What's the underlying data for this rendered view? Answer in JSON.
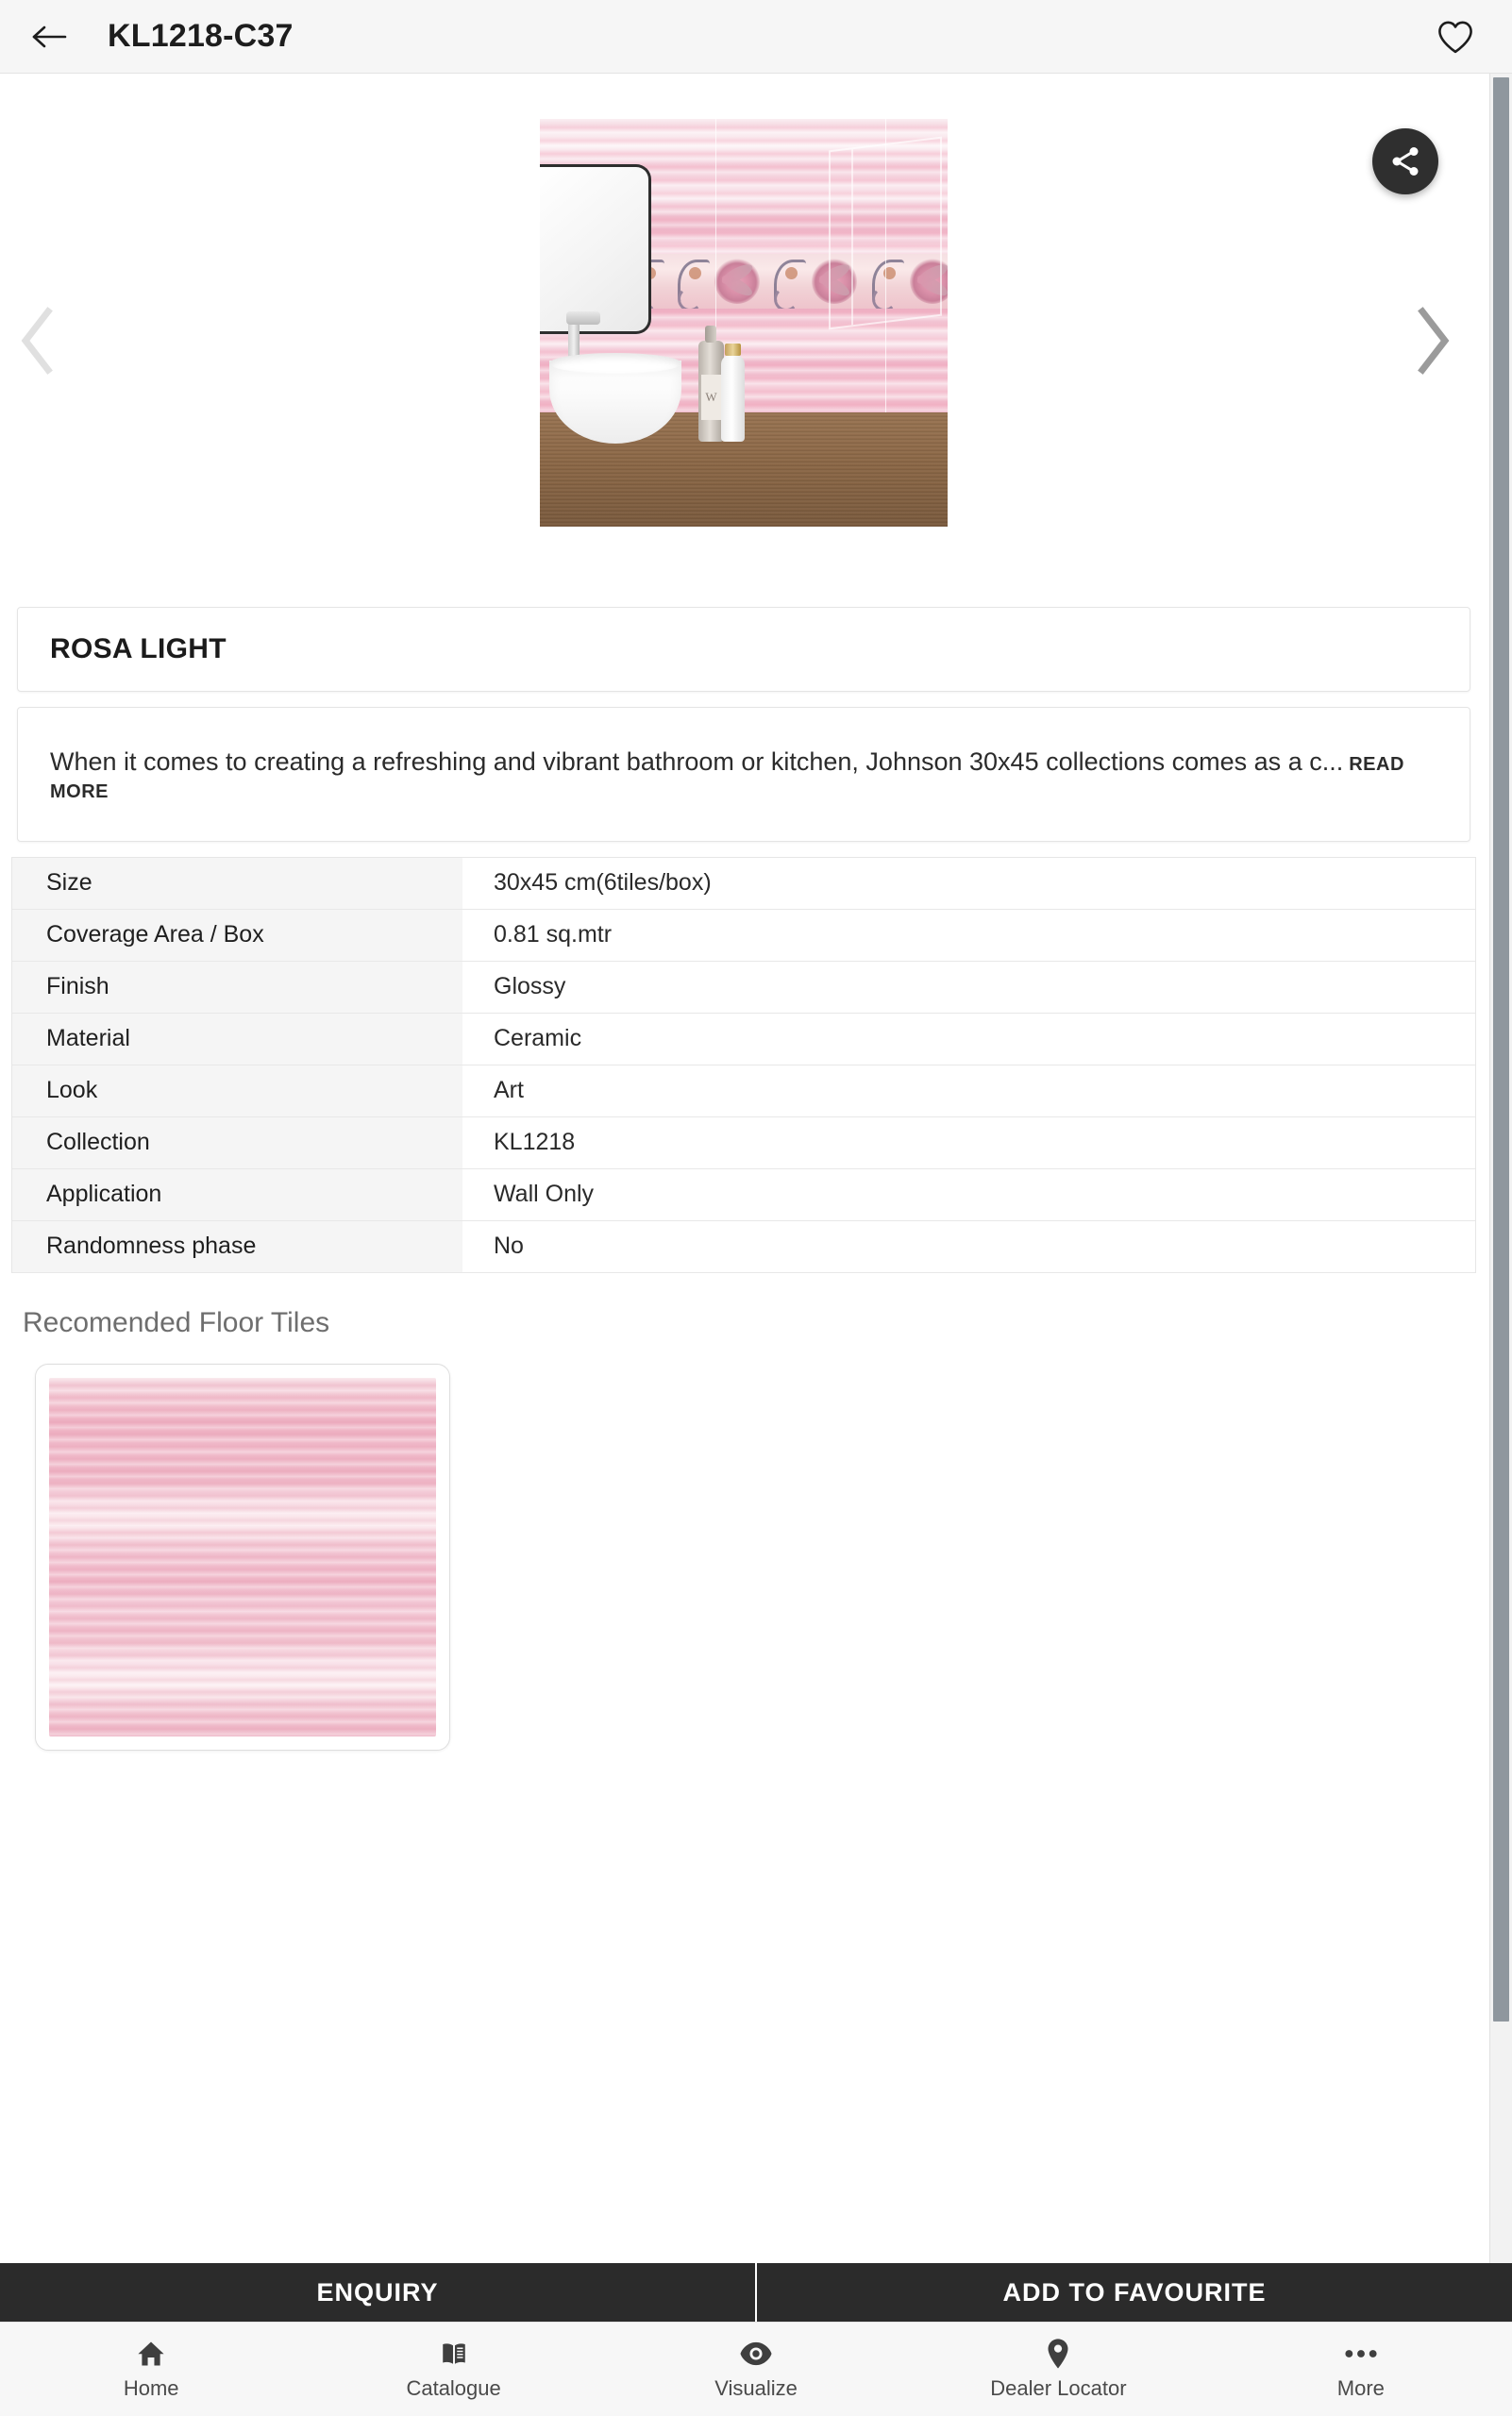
{
  "header": {
    "title": "KL1218-C37",
    "back_icon": "arrow-left-icon",
    "favourite_icon": "heart-outline-icon"
  },
  "carousel": {
    "prev_icon": "chevron-left-icon",
    "next_icon": "chevron-right-icon",
    "share_icon": "share-icon",
    "image_alt": "ROSA LIGHT pink striped bathroom wall tile with floral decor band"
  },
  "product": {
    "name": "ROSA LIGHT",
    "description": "When it comes to creating a refreshing and vibrant bathroom or kitchen, Johnson 30x45 collections comes as a c...",
    "read_more_label": "READ MORE"
  },
  "specs": [
    {
      "key": "Size",
      "value": "30x45 cm(6tiles/box)"
    },
    {
      "key": "Coverage Area / Box",
      "value": "0.81 sq.mtr"
    },
    {
      "key": "Finish",
      "value": "Glossy"
    },
    {
      "key": "Material",
      "value": "Ceramic"
    },
    {
      "key": "Look",
      "value": "Art"
    },
    {
      "key": "Collection",
      "value": "KL1218"
    },
    {
      "key": "Application",
      "value": "Wall Only"
    },
    {
      "key": "Randomness phase",
      "value": "No"
    }
  ],
  "recommended": {
    "heading": "Recomended Floor Tiles",
    "items": [
      {
        "alt": "pink striped floor tile"
      }
    ]
  },
  "actions": {
    "enquiry_label": "ENQUIRY",
    "favourite_label": "ADD TO FAVOURITE"
  },
  "bottom_nav": [
    {
      "label": "Home",
      "icon": "home-icon"
    },
    {
      "label": "Catalogue",
      "icon": "book-icon"
    },
    {
      "label": "Visualize",
      "icon": "eye-icon"
    },
    {
      "label": "Dealer Locator",
      "icon": "map-pin-icon"
    },
    {
      "label": "More",
      "icon": "ellipsis-icon"
    }
  ],
  "colors": {
    "header_bg": "#f6f6f6",
    "action_bar_bg": "#2b2b2b",
    "nav_bg": "#f7f7f7",
    "spec_key_bg": "#f5f5f5",
    "accent_pink": "#eeb0c2",
    "scrollbar_thumb": "#8f979e"
  }
}
